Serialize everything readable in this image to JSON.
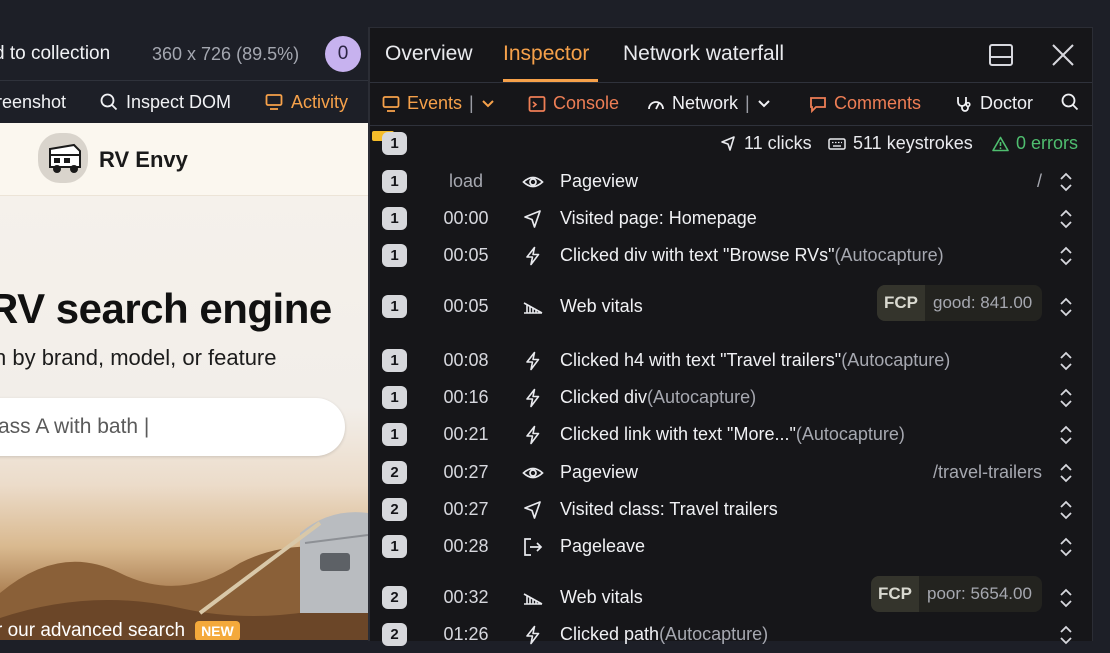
{
  "toolbar": {
    "collection_label": "d to collection",
    "dimensions": "360 x 726",
    "zoom": "(89.5%)",
    "count_badge": "0"
  },
  "subbar": {
    "screenshot_label": "reenshot",
    "inspect_label": "Inspect DOM",
    "activity_label": "Activity"
  },
  "preview": {
    "brand": "RV Envy",
    "hero_title": "RV search engine",
    "hero_sub": "h by brand, model, or feature",
    "search_placeholder": "ass A with bath |",
    "footer_text": "r our advanced search",
    "new_badge": "NEW"
  },
  "tabs": {
    "overview": "Overview",
    "inspector": "Inspector",
    "waterfall": "Network waterfall"
  },
  "filters": {
    "events": "Events",
    "console": "Console",
    "network": "Network",
    "comments": "Comments",
    "doctor": "Doctor",
    "divider": "|"
  },
  "summary": {
    "first_badge": "1",
    "clicks": "11 clicks",
    "keystrokes": "511 keystrokes",
    "errors": "0 errors"
  },
  "colors": {
    "accent": "#f6a14a",
    "console_red": "#ee7e55",
    "error_green": "#4fbe6f",
    "badge_purple": "#c7b2ef",
    "panel_bg": "#161619"
  },
  "events": [
    {
      "num": "1",
      "time": "load",
      "icon": "eye-icon",
      "label": "Pageview",
      "auto": "",
      "path": "/"
    },
    {
      "num": "1",
      "time": "00:00",
      "icon": "cursor-icon",
      "label": "Visited page: Homepage",
      "auto": "",
      "path": ""
    },
    {
      "num": "1",
      "time": "00:05",
      "icon": "bolt-icon",
      "label": "Clicked div with text \"Browse RVs\"",
      "auto": "(Autocapture)",
      "path": ""
    },
    {
      "num": "1",
      "time": "00:05",
      "icon": "vitals-icon",
      "label": "Web vitals",
      "auto": "",
      "path": "",
      "vital_key": "FCP",
      "vital_val": "good: 841.00"
    },
    {
      "num": "1",
      "time": "00:08",
      "icon": "bolt-icon",
      "label": "Clicked h4 with text \"Travel trailers\"",
      "auto": "(Autocapture)",
      "path": ""
    },
    {
      "num": "1",
      "time": "00:16",
      "icon": "bolt-icon",
      "label": "Clicked div",
      "auto": "(Autocapture)",
      "path": ""
    },
    {
      "num": "1",
      "time": "00:21",
      "icon": "bolt-icon",
      "label": "Clicked link with text \"More...\"",
      "auto": "(Autocapture)",
      "path": ""
    },
    {
      "num": "2",
      "time": "00:27",
      "icon": "eye-icon",
      "label": "Pageview",
      "auto": "",
      "path": "/travel-trailers"
    },
    {
      "num": "2",
      "time": "00:27",
      "icon": "cursor-icon",
      "label": "Visited class: Travel trailers",
      "auto": "",
      "path": ""
    },
    {
      "num": "1",
      "time": "00:28",
      "icon": "exit-icon",
      "label": "Pageleave",
      "auto": "",
      "path": ""
    },
    {
      "num": "2",
      "time": "00:32",
      "icon": "vitals-icon",
      "label": "Web vitals",
      "auto": "",
      "path": "",
      "vital_key": "FCP",
      "vital_val": "poor: 5654.00"
    },
    {
      "num": "2",
      "time": "01:26",
      "icon": "bolt-icon",
      "label": "Clicked path",
      "auto": "(Autocapture)",
      "path": ""
    }
  ]
}
